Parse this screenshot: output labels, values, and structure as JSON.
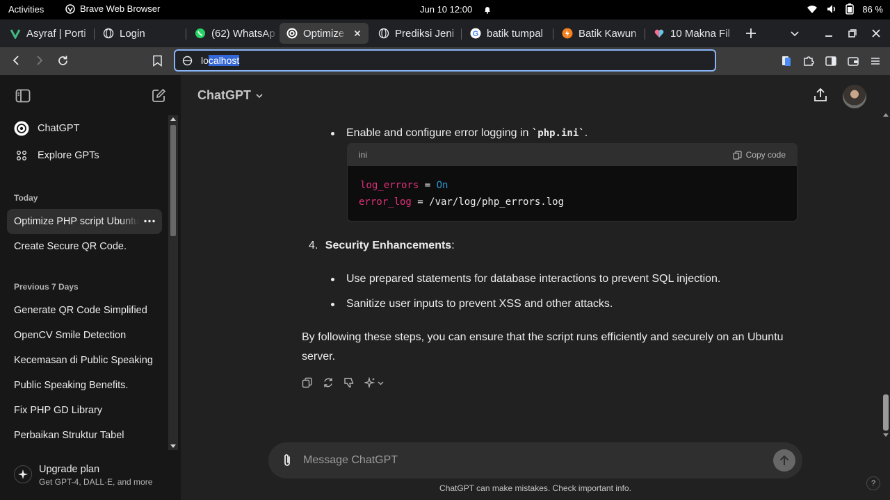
{
  "topbar": {
    "activities": "Activities",
    "app_name": "Brave Web Browser",
    "clock": "Jun 10  12:00",
    "battery": "86 %"
  },
  "tabs": [
    {
      "label": "Asyraf | Porti",
      "favicon": "v-logo-icon"
    },
    {
      "label": "Login",
      "favicon": "globe-icon"
    },
    {
      "label": "(62) WhatsAp",
      "favicon": "whatsapp-icon"
    },
    {
      "label": "Optimize",
      "favicon": "chatgpt-icon",
      "active": true
    },
    {
      "label": "Prediksi Jeni",
      "favicon": "globe-icon"
    },
    {
      "label": "batik tumpal",
      "favicon": "google-icon"
    },
    {
      "label": "Batik Kawun",
      "favicon": "orange-logo-icon"
    },
    {
      "label": "10 Makna Fil",
      "favicon": "heart-icon"
    }
  ],
  "address": {
    "prefix": "lo",
    "selected": "calhost"
  },
  "sidebar": {
    "top": [
      {
        "label": "ChatGPT"
      },
      {
        "label": "Explore GPTs"
      }
    ],
    "today_heading": "Today",
    "today": [
      {
        "label": "Optimize PHP script Ubuntu",
        "active": true
      },
      {
        "label": "Create Secure QR Code."
      }
    ],
    "prev_heading": "Previous 7 Days",
    "prev": [
      {
        "label": "Generate QR Code Simplified"
      },
      {
        "label": "OpenCV Smile Detection"
      },
      {
        "label": "Kecemasan di Public Speaking"
      },
      {
        "label": "Public Speaking Benefits."
      },
      {
        "label": "Fix PHP GD Library"
      },
      {
        "label": "Perbaikan Struktur Tabel"
      }
    ],
    "upgrade": {
      "title": "Upgrade plan",
      "subtitle": "Get GPT-4, DALL·E, and more"
    }
  },
  "header": {
    "model": "ChatGPT"
  },
  "chat": {
    "bullet1_pre": "Enable and configure error logging in ",
    "bullet1_code": "`php.ini`",
    "bullet1_post": ".",
    "code_lang": "ini",
    "copy_label": "Copy code",
    "code_lines": [
      {
        "key": "log_errors",
        "eq": " = ",
        "val": "On"
      },
      {
        "key": "error_log",
        "eq": " = /var/log/php_errors.log",
        "val": ""
      }
    ],
    "step_number": "4.",
    "step_title": "Security Enhancements",
    "step_colon": ":",
    "bullets": [
      "Use prepared statements for database interactions to prevent SQL injection.",
      "Sanitize user inputs to prevent XSS and other attacks."
    ],
    "conclusion_line1": "By following these steps, you can ensure that the script runs efficiently and securely on an Ubuntu",
    "conclusion_line2": "server."
  },
  "composer": {
    "placeholder": "Message ChatGPT"
  },
  "footer": {
    "disclaimer": "ChatGPT can make mistakes. Check important info.",
    "help": "?"
  }
}
